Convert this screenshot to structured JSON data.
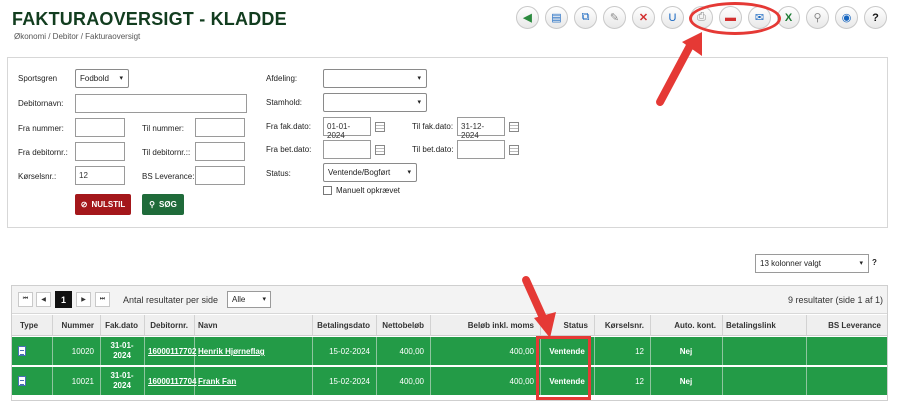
{
  "header": {
    "title": "FAKTURAOVERSIGT - KLADDE",
    "breadcrumb": "Økonomi / Debitor / Fakturaoversigt"
  },
  "toolbar": [
    {
      "name": "back-icon",
      "glyph": "◀",
      "tone": "green"
    },
    {
      "name": "document-icon",
      "glyph": "▤",
      "tone": "blue"
    },
    {
      "name": "copy-icon",
      "glyph": "⧉",
      "tone": "blue"
    },
    {
      "name": "edit-icon",
      "glyph": "✎",
      "tone": "gray"
    },
    {
      "name": "delete-icon",
      "glyph": "✕",
      "tone": "red"
    },
    {
      "name": "lock-icon",
      "glyph": "U",
      "tone": "blue"
    },
    {
      "name": "print-icon",
      "glyph": "⎙",
      "tone": "gray"
    },
    {
      "name": "pdf-icon",
      "glyph": "▬",
      "tone": "red"
    },
    {
      "name": "email-icon",
      "glyph": "✉",
      "tone": "blue"
    },
    {
      "name": "excel-icon",
      "glyph": "X",
      "tone": "excel"
    },
    {
      "name": "search-icon",
      "glyph": "⚲",
      "tone": "gray"
    },
    {
      "name": "settings-icon",
      "glyph": "◉",
      "tone": "blue"
    },
    {
      "name": "help-icon",
      "glyph": "?",
      "tone": "dark"
    }
  ],
  "filters": {
    "sportsgren_label": "Sportsgren",
    "sportsgren_value": "Fodbold",
    "debitornavn_label": "Debitornavn:",
    "fra_nummer_label": "Fra nummer:",
    "til_nummer_label": "Til nummer:",
    "fra_debitornr_label": "Fra debitornr.:",
    "til_debitornr_label": "Til debitornr.::",
    "kerselsnr_label": "Kørselsnr.:",
    "kerselsnr_value": "12",
    "bs_leverance_label": "BS Leverance:",
    "afdeling_label": "Afdeling:",
    "afdeling_value": "",
    "stamhold_label": "Stamhold:",
    "stamhold_value": "",
    "fra_fak_dato_label": "Fra fak.dato:",
    "fra_fak_dato_value": "01-01-2024",
    "til_fak_dato_label": "Til fak.dato:",
    "til_fak_dato_value": "31-12-2024",
    "fra_bet_dato_label": "Fra bet.dato:",
    "til_bet_dato_label": "Til bet.dato:",
    "status_label": "Status:",
    "status_value": "Ventende/Bogført",
    "manuelt_label": "Manuelt opkrævet",
    "reset_label": "NULSTIL",
    "search_label": "SØG"
  },
  "columns_select": "13 kolonner valgt",
  "columns_help": "?",
  "pager": {
    "first": "⏮",
    "prev": "◀",
    "current_page": "1",
    "next": "▶",
    "last": "⏭",
    "per_page_label": "Antal resultater per side",
    "per_page_value": "Alle",
    "results_text": "9 resultater (side 1 af 1)"
  },
  "table": {
    "headers": [
      "Type",
      "Nummer",
      "Fak.dato",
      "Debitornr.",
      "Navn",
      "Betalingsdato",
      "Nettobeløb",
      "Beløb inkl. moms",
      "Status",
      "Kørselsnr.",
      "Auto. kont.",
      "Betalingslink",
      "BS Leverance"
    ],
    "rows": [
      {
        "type_icon": "document-icon",
        "nummer": "10020",
        "fak_dato_1": "31-01-",
        "fak_dato_2": "2024",
        "debitornr": "16000117702",
        "navn": "Henrik Hjørneflag",
        "betalingsdato": "15-02-2024",
        "netto": "400,00",
        "inkl_moms": "400,00",
        "status": "Ventende",
        "kerselsnr": "12",
        "auto_kont": "Nej",
        "betalingslink": "",
        "bs_leverance": ""
      },
      {
        "type_icon": "document-icon",
        "nummer": "10021",
        "fak_dato_1": "31-01-",
        "fak_dato_2": "2024",
        "debitornr": "16000117704",
        "navn": "Frank Fan",
        "betalingsdato": "15-02-2024",
        "netto": "400,00",
        "inkl_moms": "400,00",
        "status": "Ventende",
        "kerselsnr": "12",
        "auto_kont": "Nej",
        "betalingslink": "",
        "bs_leverance": ""
      }
    ]
  },
  "colors": {
    "row_green": "#239b47",
    "highlight_red": "#e53935",
    "reset_red": "#a4171b",
    "search_green": "#1f6b3a"
  }
}
